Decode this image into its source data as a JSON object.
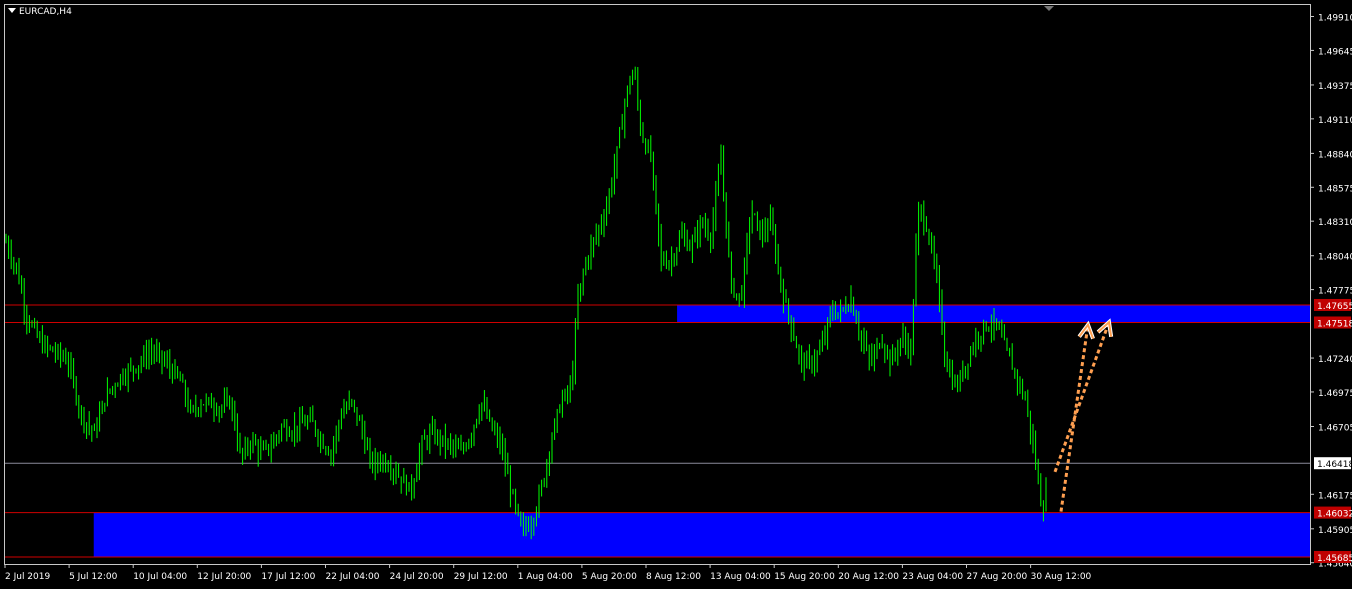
{
  "window": {
    "symbol_title": "EURCAD,H4"
  },
  "colors": {
    "background": "#000000",
    "candle": "#00ff00",
    "zone": "#0000ff",
    "level_line": "#d00000",
    "current_line": "#8a8a9a",
    "arrow": "#ff9f50",
    "axis_text": "#ffffff",
    "marker_red": "#c00000"
  },
  "price_axis": {
    "ticks": [
      "1.49910",
      "1.49645",
      "1.49375",
      "1.49110",
      "1.48840",
      "1.48575",
      "1.48310",
      "1.48040",
      "1.47775",
      "1.47240",
      "1.46975",
      "1.46705",
      "1.46175",
      "1.45905",
      "1.45640"
    ],
    "min": 1.4563,
    "max": 1.5,
    "markers": [
      {
        "label": "1.47655",
        "value": 1.47655,
        "kind": "level"
      },
      {
        "label": "1.47518",
        "value": 1.47518,
        "kind": "level"
      },
      {
        "label": "1.46418",
        "value": 1.46418,
        "kind": "current"
      },
      {
        "label": "1.46032",
        "value": 1.46032,
        "kind": "level"
      },
      {
        "label": "1.45685",
        "value": 1.45685,
        "kind": "level"
      }
    ]
  },
  "time_axis": {
    "labels": [
      "2 Jul 2019",
      "5 Jul 12:00",
      "10 Jul 04:00",
      "12 Jul 20:00",
      "17 Jul 12:00",
      "22 Jul 04:00",
      "24 Jul 20:00",
      "29 Jul 12:00",
      "1 Aug 04:00",
      "5 Aug 20:00",
      "8 Aug 12:00",
      "13 Aug 04:00",
      "15 Aug 20:00",
      "20 Aug 12:00",
      "23 Aug 04:00",
      "27 Aug 20:00",
      "30 Aug 12:00"
    ]
  },
  "zones": [
    {
      "name": "resistance-zone",
      "top": 1.47655,
      "bottom": 1.47518,
      "start_fraction": 0.515
    },
    {
      "name": "support-zone",
      "top": 1.46032,
      "bottom": 1.45685,
      "start_fraction": 0.068
    }
  ],
  "chart_data": {
    "type": "candlestick",
    "title": "EURCAD,H4",
    "ylim": [
      1.4563,
      1.5
    ],
    "close_path": [
      [
        0,
        1.4815
      ],
      [
        12,
        1.479
      ],
      [
        20,
        1.4758
      ],
      [
        35,
        1.4735
      ],
      [
        50,
        1.4728
      ],
      [
        62,
        1.4722
      ],
      [
        75,
        1.468
      ],
      [
        88,
        1.4665
      ],
      [
        100,
        1.4695
      ],
      [
        115,
        1.471
      ],
      [
        130,
        1.4718
      ],
      [
        145,
        1.473
      ],
      [
        160,
        1.472
      ],
      [
        175,
        1.4705
      ],
      [
        185,
        1.468
      ],
      [
        195,
        1.469
      ],
      [
        205,
        1.4688
      ],
      [
        215,
        1.4685
      ],
      [
        225,
        1.469
      ],
      [
        235,
        1.4645
      ],
      [
        245,
        1.466
      ],
      [
        255,
        1.465
      ],
      [
        265,
        1.4655
      ],
      [
        275,
        1.467
      ],
      [
        285,
        1.4668
      ],
      [
        295,
        1.4672
      ],
      [
        305,
        1.4675
      ],
      [
        315,
        1.466
      ],
      [
        325,
        1.465
      ],
      [
        335,
        1.468
      ],
      [
        345,
        1.469
      ],
      [
        355,
        1.467
      ],
      [
        365,
        1.464
      ],
      [
        375,
        1.4645
      ],
      [
        385,
        1.464
      ],
      [
        395,
        1.463
      ],
      [
        405,
        1.462
      ],
      [
        415,
        1.4655
      ],
      [
        425,
        1.4665
      ],
      [
        435,
        1.466
      ],
      [
        445,
        1.4655
      ],
      [
        455,
        1.465
      ],
      [
        465,
        1.4665
      ],
      [
        475,
        1.469
      ],
      [
        485,
        1.467
      ],
      [
        495,
        1.4655
      ],
      [
        505,
        1.462
      ],
      [
        515,
        1.459
      ],
      [
        525,
        1.4595
      ],
      [
        535,
        1.462
      ],
      [
        545,
        1.466
      ],
      [
        555,
        1.469
      ],
      [
        565,
        1.47
      ],
      [
        572,
        1.477
      ],
      [
        580,
        1.48
      ],
      [
        590,
        1.482
      ],
      [
        600,
        1.484
      ],
      [
        610,
        1.488
      ],
      [
        620,
        1.493
      ],
      [
        628,
        1.495
      ],
      [
        635,
        1.49
      ],
      [
        645,
        1.488
      ],
      [
        655,
        1.48
      ],
      [
        665,
        1.48
      ],
      [
        675,
        1.482
      ],
      [
        685,
        1.481
      ],
      [
        695,
        1.483
      ],
      [
        705,
        1.482
      ],
      [
        715,
        1.488
      ],
      [
        725,
        1.478
      ],
      [
        735,
        1.477
      ],
      [
        745,
        1.484
      ],
      [
        755,
        1.482
      ],
      [
        765,
        1.483
      ],
      [
        775,
        1.478
      ],
      [
        785,
        1.475
      ],
      [
        795,
        1.472
      ],
      [
        805,
        1.472
      ],
      [
        815,
        1.473
      ],
      [
        825,
        1.476
      ],
      [
        835,
        1.476
      ],
      [
        845,
        1.477
      ],
      [
        855,
        1.474
      ],
      [
        865,
        1.472
      ],
      [
        875,
        1.474
      ],
      [
        885,
        1.472
      ],
      [
        895,
        1.474
      ],
      [
        905,
        1.473
      ],
      [
        912,
        1.484
      ],
      [
        920,
        1.483
      ],
      [
        930,
        1.479
      ],
      [
        940,
        1.472
      ],
      [
        950,
        1.47
      ],
      [
        960,
        1.472
      ],
      [
        970,
        1.474
      ],
      [
        980,
        1.475
      ],
      [
        990,
        1.475
      ],
      [
        1000,
        1.473
      ],
      [
        1010,
        1.471
      ],
      [
        1020,
        1.469
      ],
      [
        1030,
        1.464
      ],
      [
        1036,
        1.4605
      ],
      [
        1042,
        1.4625
      ]
    ],
    "annotations": [
      {
        "type": "arrow",
        "from": [
          1056,
          1.4604
        ],
        "to": [
          1083,
          1.475
        ]
      },
      {
        "type": "arrow",
        "from": [
          1050,
          1.4635
        ],
        "to": [
          1104,
          1.4752
        ]
      }
    ]
  }
}
